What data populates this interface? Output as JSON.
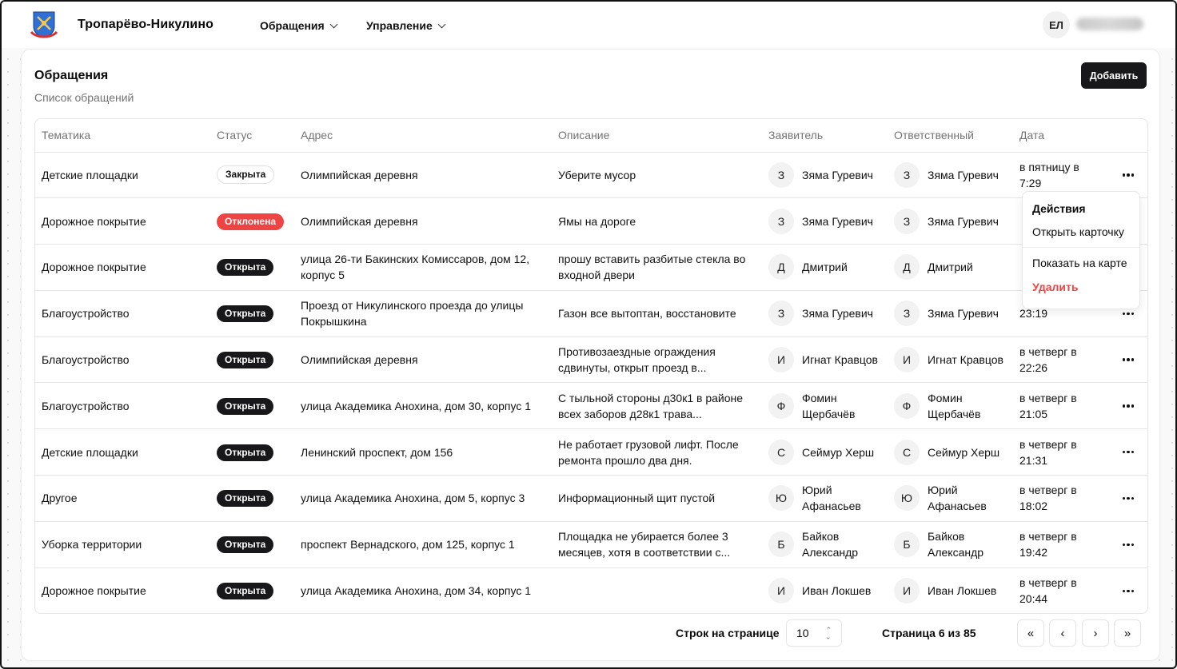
{
  "header": {
    "brand": "Тропарёво-Никулино",
    "nav": [
      {
        "label": "Обращения"
      },
      {
        "label": "Управление"
      }
    ],
    "user_initials": "ЕЛ"
  },
  "page": {
    "title": "Обращения",
    "subtitle": "Список обращений",
    "add_label": "Добавить"
  },
  "table": {
    "columns": [
      "Тематика",
      "Статус",
      "Адрес",
      "Описание",
      "Заявитель",
      "Ответственный",
      "Дата"
    ],
    "rows": [
      {
        "topic": "Детские площадки",
        "status": "Закрыта",
        "status_kind": "closed",
        "address": "Олимпийская деревня",
        "description": "Уберите мусор",
        "applicant_initial": "З",
        "applicant": "Зяма Гуревич",
        "responsible_initial": "З",
        "responsible": "Зяма Гуревич",
        "date": "в пятницу в 7:29"
      },
      {
        "topic": "Дорожное покрытие",
        "status": "Отклонена",
        "status_kind": "rejected",
        "address": "Олимпийская деревня",
        "description": "Ямы на дороге",
        "applicant_initial": "З",
        "applicant": "Зяма Гуревич",
        "responsible_initial": "З",
        "responsible": "Зяма Гуревич",
        "date": ""
      },
      {
        "topic": "Дорожное покрытие",
        "status": "Открыта",
        "status_kind": "open",
        "address": "улица 26-ти Бакинских Комиссаров, дом 12, корпус 5",
        "description": "прошу вставить разбитые стекла во входной двери",
        "applicant_initial": "Д",
        "applicant": "Дмитрий",
        "responsible_initial": "Д",
        "responsible": "Дмитрий",
        "date": ""
      },
      {
        "topic": "Благоустройство",
        "status": "Открыта",
        "status_kind": "open",
        "address": "Проезд от Никулинского проезда до улицы Покрышкина",
        "description": "Газон все вытоптан, восстановите",
        "applicant_initial": "З",
        "applicant": "Зяма Гуревич",
        "responsible_initial": "З",
        "responsible": "Зяма Гуревич",
        "date": "23:19"
      },
      {
        "topic": "Благоустройство",
        "status": "Открыта",
        "status_kind": "open",
        "address": "Олимпийская деревня",
        "description": "Противозаездные ограждения сдвинуты, открыт проезд в...",
        "applicant_initial": "И",
        "applicant": "Игнат Кравцов",
        "responsible_initial": "И",
        "responsible": "Игнат Кравцов",
        "date": "в четверг в 22:26"
      },
      {
        "topic": "Благоустройство",
        "status": "Открыта",
        "status_kind": "open",
        "address": "улица Академика Анохина, дом 30, корпус 1",
        "description": "С тыльной стороны д30к1 в районе всех заборов д28к1 трава...",
        "applicant_initial": "Ф",
        "applicant": "Фомин Щербачёв",
        "responsible_initial": "Ф",
        "responsible": "Фомин Щербачёв",
        "date": "в четверг в 21:05"
      },
      {
        "topic": "Детские площадки",
        "status": "Открыта",
        "status_kind": "open",
        "address": "Ленинский проспект, дом 156",
        "description": "Не работает грузовой лифт. После ремонта прошло два дня.",
        "applicant_initial": "С",
        "applicant": "Сеймур Херш",
        "responsible_initial": "С",
        "responsible": "Сеймур Херш",
        "date": "в четверг в 21:31"
      },
      {
        "topic": "Другое",
        "status": "Открыта",
        "status_kind": "open",
        "address": "улица Академика Анохина, дом 5, корпус 3",
        "description": "Информационный щит пустой",
        "applicant_initial": "Ю",
        "applicant": "Юрий Афанасьев",
        "responsible_initial": "Ю",
        "responsible": "Юрий Афанасьев",
        "date": "в четверг в 18:02"
      },
      {
        "topic": "Уборка территории",
        "status": "Открыта",
        "status_kind": "open",
        "address": "проспект Вернадского, дом 125, корпус 1",
        "description": "Площадка не убирается более 3 месяцев, хотя в соответствии с...",
        "applicant_initial": "Б",
        "applicant": "Байков Александр",
        "responsible_initial": "Б",
        "responsible": "Байков Александр",
        "date": "в четверг в 19:42"
      },
      {
        "topic": "Дорожное покрытие",
        "status": "Открыта",
        "status_kind": "open",
        "address": "улица Академика Анохина, дом 34, корпус 1",
        "description": "",
        "applicant_initial": "И",
        "applicant": "Иван Локшев",
        "responsible_initial": "И",
        "responsible": "Иван Локшев",
        "date": "в четверг в 20:44"
      }
    ]
  },
  "menu": {
    "title": "Действия",
    "items": [
      "Открыть карточку",
      "Показать на карте"
    ],
    "delete_label": "Удалить"
  },
  "pagination": {
    "rows_label": "Строк на странице",
    "rows_value": "10",
    "page_info": "Страница 6 из 85",
    "buttons": [
      "«",
      "‹",
      "›",
      "»"
    ]
  },
  "colors": {
    "accent": "#18181b",
    "danger": "#ef4444",
    "muted": "#737373"
  }
}
